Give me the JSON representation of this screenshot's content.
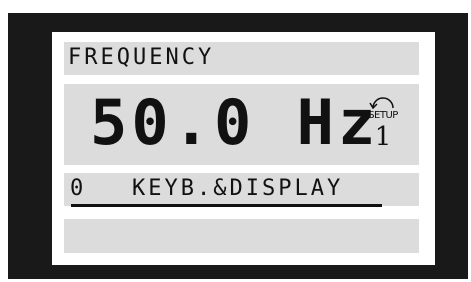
{
  "display": {
    "line1": {
      "parameter_name": "FREQUENCY"
    },
    "line2": {
      "reading": "50.0 Hz",
      "setup_label": "SETUP",
      "setup_number": "1",
      "setup_icon": "circular-arrow-icon"
    },
    "line3": {
      "menu_index": "0",
      "menu_label": "KEYB.&DISPLAY"
    },
    "line4": {}
  },
  "colors": {
    "bezel": "#191919",
    "screen": "#ffffff",
    "row_background": "#dcdcdc",
    "text": "#111111"
  }
}
